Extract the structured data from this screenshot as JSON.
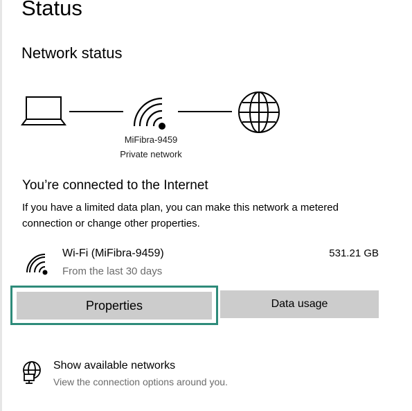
{
  "page": {
    "title": "Status"
  },
  "network_status": {
    "heading": "Network status",
    "network_name": "MiFibra-9459",
    "network_type": "Private network"
  },
  "connection_status": {
    "heading": "You’re connected to the Internet",
    "description": "If you have a limited data plan, you can make this network a metered connection or change other properties."
  },
  "connection": {
    "name": "Wi-Fi (MiFibra-9459)",
    "period": "From the last 30 days",
    "usage": "531.21 GB"
  },
  "buttons": {
    "properties": "Properties",
    "data_usage": "Data usage"
  },
  "available_networks": {
    "title": "Show available networks",
    "subtitle": "View the connection options around you."
  },
  "colors": {
    "focus_ring": "#2e8b7a",
    "button_bg": "#cccccc",
    "secondary_text": "#6b6b6b"
  }
}
